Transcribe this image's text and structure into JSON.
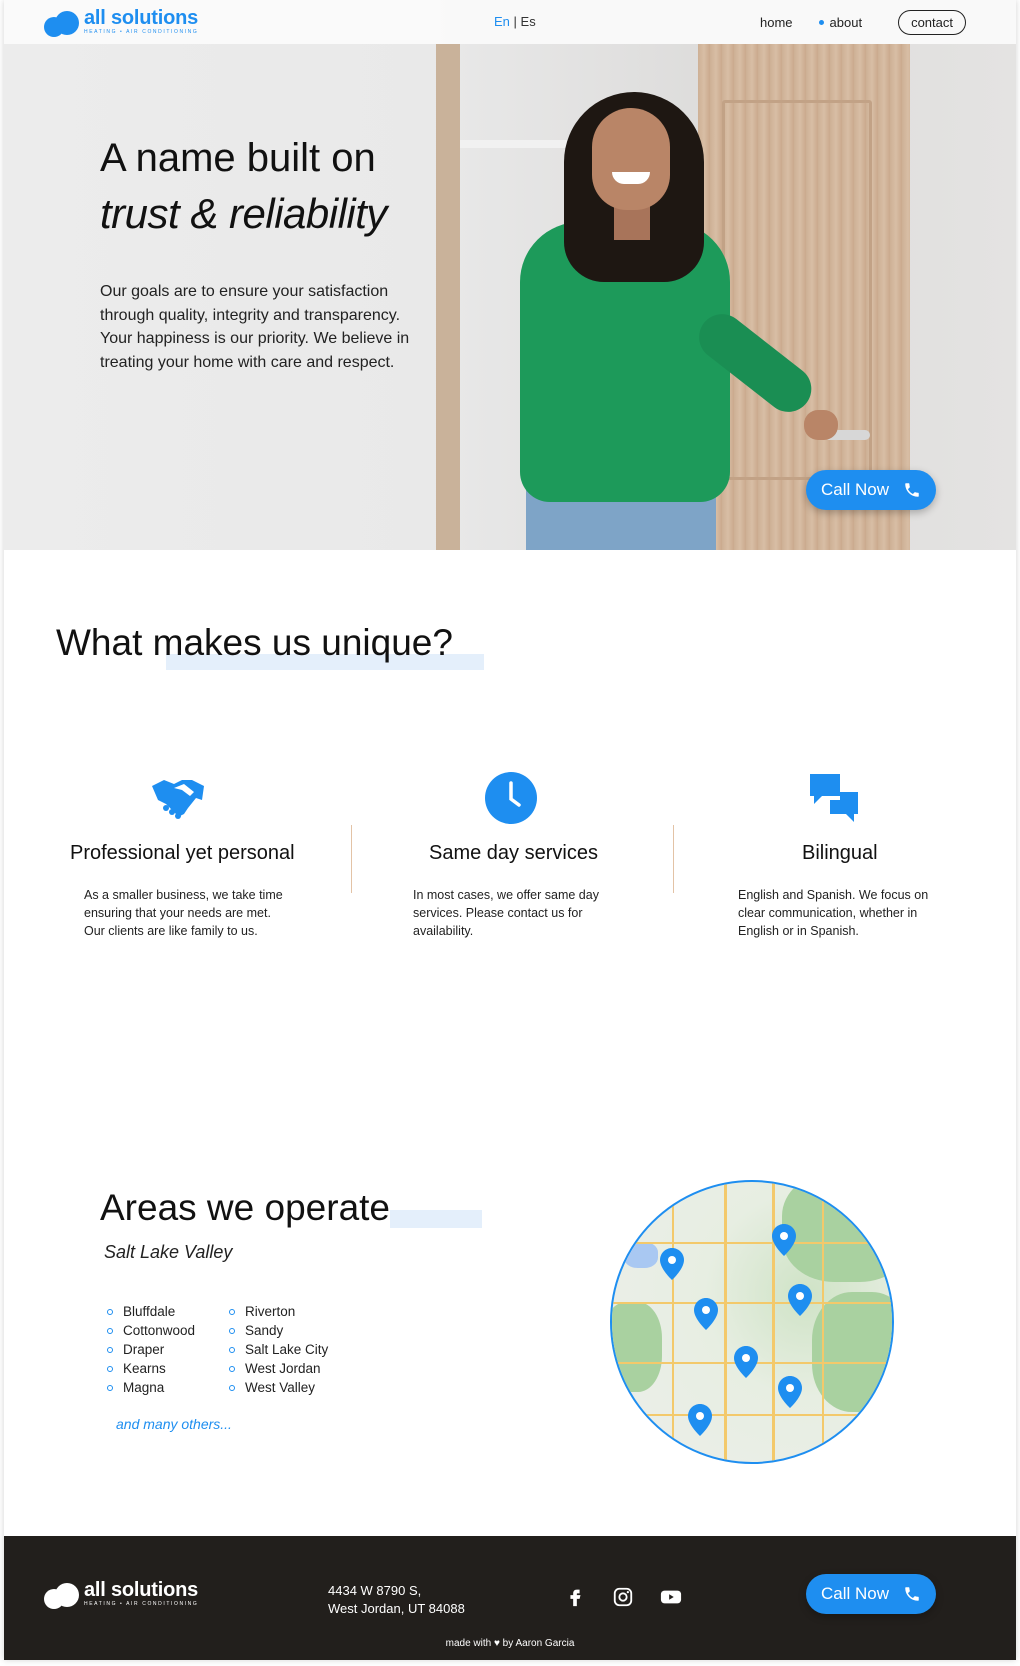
{
  "header": {
    "logo_name": "all solutions",
    "logo_tagline": "HEATING • AIR CONDITIONING",
    "lang_en": "En",
    "lang_sep": "|",
    "lang_es": "Es",
    "nav_home": "home",
    "nav_about": "about",
    "nav_contact": "contact"
  },
  "hero": {
    "title_line1": "A name built on",
    "title_line2": "trust & reliability",
    "text": "Our goals are to ensure your satisfaction through quality, integrity and transparency. Your happiness is our priority. We believe in treating your home with care and respect.",
    "call_label": "Call Now"
  },
  "unique": {
    "title": "What makes us unique?",
    "features": [
      {
        "title": "Professional yet personal",
        "text": "As a smaller business, we take time ensuring that your needs are met. Our clients are like family to us.",
        "icon": "handshake-icon"
      },
      {
        "title": "Same day services",
        "text": "In most cases, we offer same day services. Please contact us for availability.",
        "icon": "clock-icon"
      },
      {
        "title": "Bilingual",
        "text": "English and Spanish. We focus on clear communication, whether in English or in Spanish.",
        "icon": "chat-bubbles-icon"
      }
    ]
  },
  "areas": {
    "title": "Areas we operate",
    "subtitle": "Salt Lake Valley",
    "col1": [
      "Bluffdale",
      "Cottonwood",
      "Draper",
      "Kearns",
      "Magna"
    ],
    "col2": [
      "Riverton",
      "Sandy",
      "Salt Lake City",
      "West Jordan",
      "West Valley"
    ],
    "more": "and many others..."
  },
  "footer": {
    "logo_name": "all solutions",
    "logo_tagline": "HEATING • AIR CONDITIONING",
    "address_line1": "4434 W 8790 S,",
    "address_line2": "West Jordan, UT 84088",
    "call_label": "Call Now",
    "credit": "made with ♥ by Aaron Garcia"
  },
  "colors": {
    "accent": "#1e8ef0",
    "footer_bg": "#221f1c",
    "highlight": "#e4effb"
  }
}
